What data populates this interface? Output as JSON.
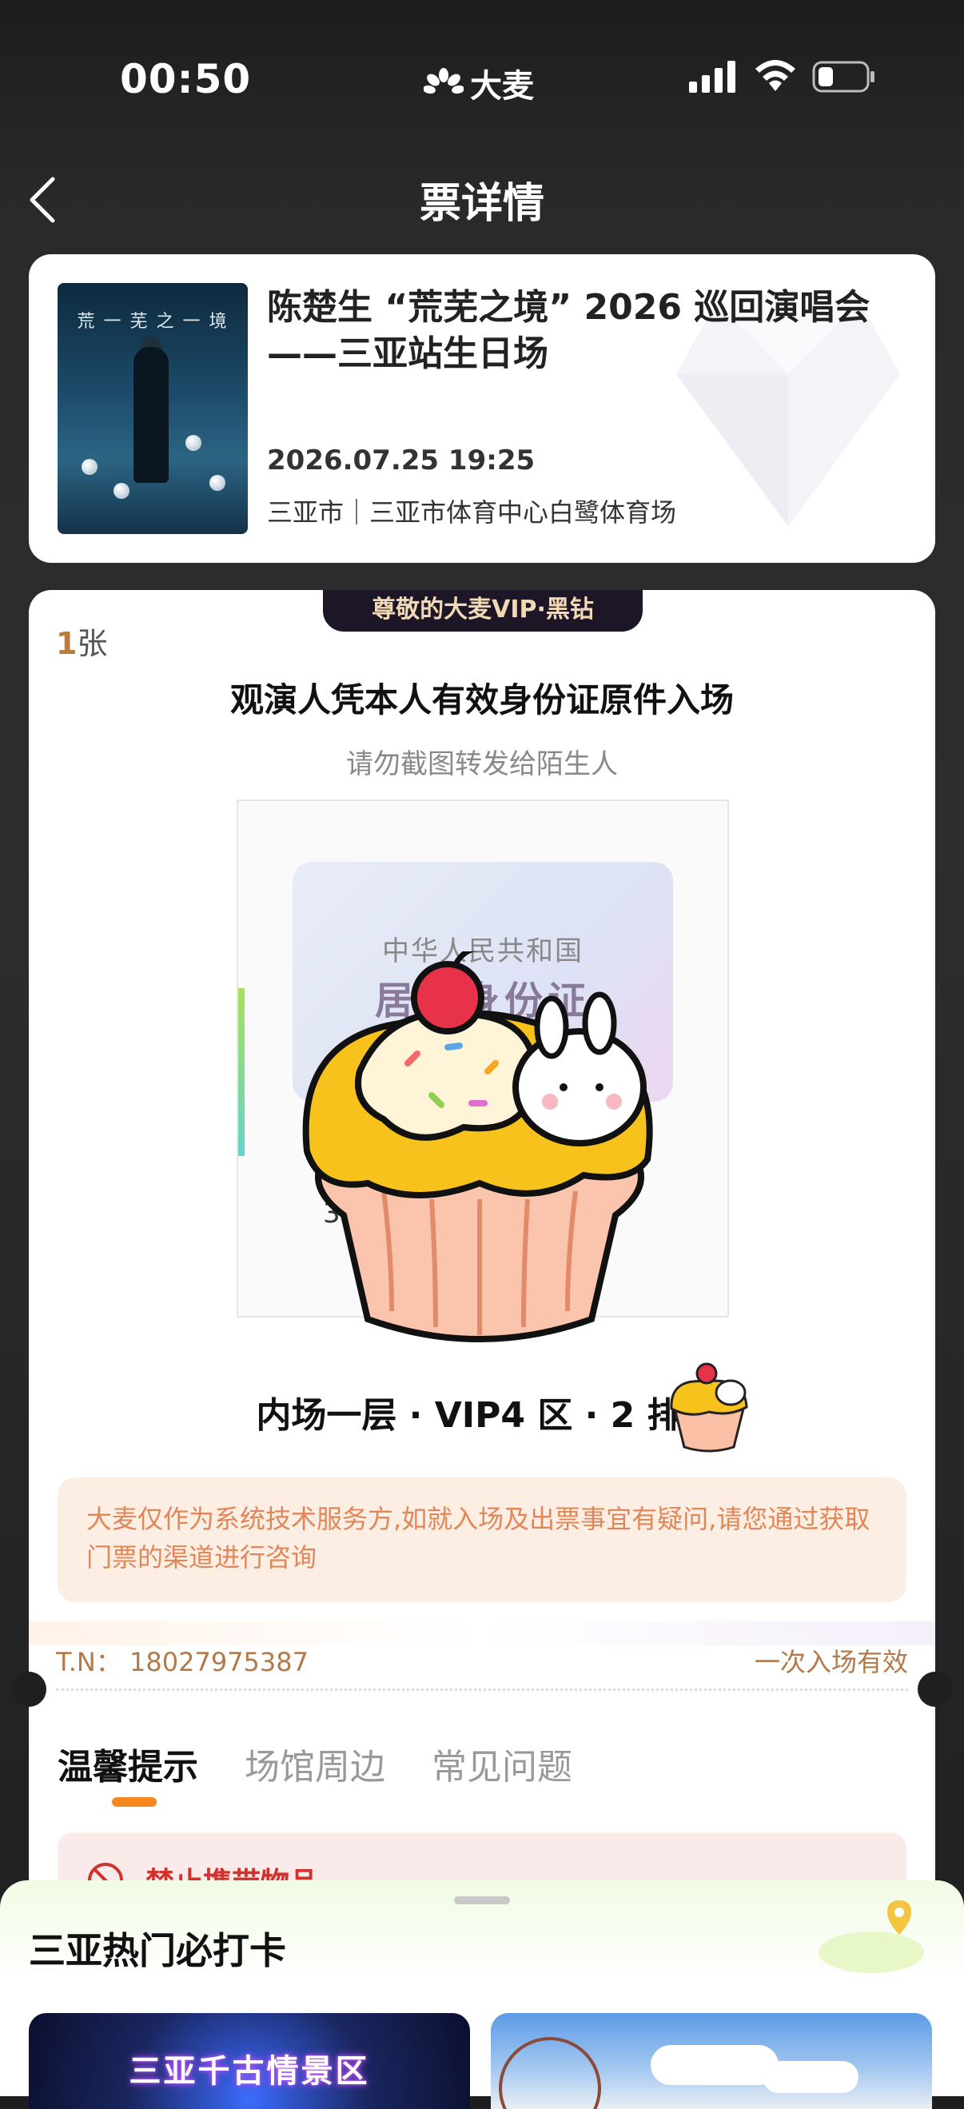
{
  "status_bar": {
    "time": "00:50",
    "brand": "大麦"
  },
  "nav": {
    "title": "票详情"
  },
  "event": {
    "title": "陈楚生 “荒芜之境” 2026 巡回演唱会——三亚站生日场",
    "datetime": "2026.07.25 19:25",
    "venue": "三亚市｜三亚市体育中心白鹭体育场",
    "poster_title": "荒 一 芜 之 一 境"
  },
  "ticket": {
    "vip_badge": "尊敬的大麦VIP·黑钻",
    "count_number": "1",
    "count_unit": "张",
    "entry_rule": "观演人凭本人有效身份证原件入场",
    "warning": "请勿截图转发给陌生人",
    "id_card": {
      "line1": "中华人民共和国",
      "line2": "居民身份证",
      "partial_number": "3"
    },
    "seat": "内场一层 · VIP4 区 · 2 排 ·",
    "notice": "大麦仅作为系统技术服务方,如就入场及出票事宜有疑问,请您通过获取门票的渠道进行咨询",
    "tn": "T.N： 18027975387",
    "validity": "一次入场有效"
  },
  "tabs": [
    {
      "label": "温馨提示",
      "active": true
    },
    {
      "label": "场馆周边",
      "active": false
    },
    {
      "label": "常见问题",
      "active": false
    }
  ],
  "alert": {
    "text": "禁止携带物品"
  },
  "bottom_sheet": {
    "title": "三亚热门必打卡",
    "cards": [
      {
        "label": "三亚千古情景区"
      },
      {
        "label": ""
      }
    ]
  },
  "colors": {
    "accent": "#f5891f",
    "notice_text": "#e0875a",
    "vip_badge_bg": "#1c1626",
    "alert_text": "#d0332e"
  }
}
